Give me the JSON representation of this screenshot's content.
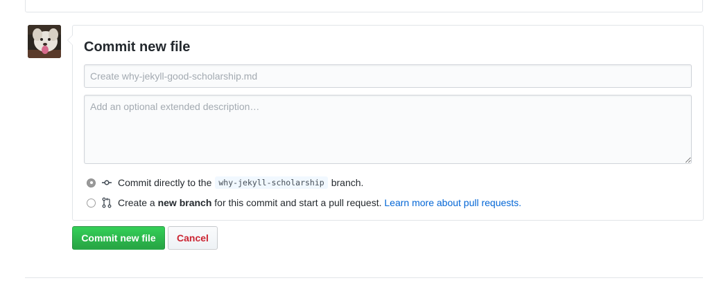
{
  "commit_form": {
    "title": "Commit new file",
    "summary_placeholder": "Create why-jekyll-good-scholarship.md",
    "summary_value": "",
    "description_placeholder": "Add an optional extended description…",
    "description_value": "",
    "options": {
      "direct": {
        "selected": true,
        "prefix": "Commit directly to the",
        "branch_name": "why-jekyll-scholarship",
        "suffix": "branch.",
        "icon": "git-commit-icon"
      },
      "new_branch": {
        "selected": false,
        "prefix": "Create a",
        "bold_text": "new branch",
        "middle": "for this commit and start a pull request.",
        "link_text": "Learn more about pull requests.",
        "icon": "git-pull-request-icon"
      }
    },
    "buttons": {
      "commit_label": "Commit new file",
      "cancel_label": "Cancel"
    }
  },
  "user": {
    "avatar_icon": "user-avatar"
  },
  "colors": {
    "commit_button": "#28a745",
    "cancel_text": "#cb2431",
    "link": "#0366d6",
    "branch_code_bg": "#f1f8ff"
  }
}
